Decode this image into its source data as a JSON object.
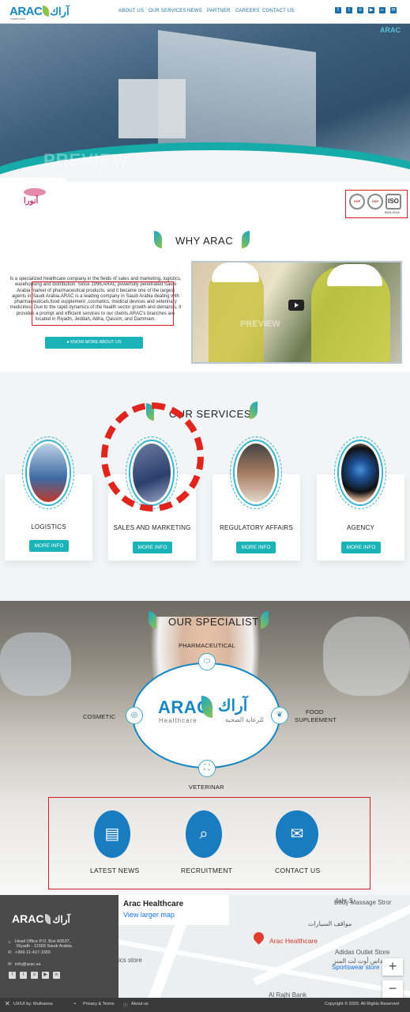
{
  "header": {
    "logo_en": "ARAC",
    "logo_ar": "آراك",
    "logo_tagline": "Healthcare",
    "nav": [
      "ABOUT US",
      "OUR SERVICES",
      "NEWS",
      "PARTNER",
      "CAREERS",
      "CONTACT US"
    ],
    "social": [
      {
        "icon": "facebook-icon",
        "glyph": "f"
      },
      {
        "icon": "twitter-icon",
        "glyph": "t"
      },
      {
        "icon": "instagram-icon",
        "glyph": "o"
      },
      {
        "icon": "youtube-icon",
        "glyph": "▶"
      },
      {
        "icon": "linkedin-icon",
        "glyph": "in"
      },
      {
        "icon": "email-icon",
        "glyph": "✉"
      }
    ]
  },
  "hero": {
    "watermark": "PREVIEW",
    "logo": "ARAC"
  },
  "partners": {
    "brand": "أنورا",
    "certs": [
      "GDP",
      "GSP",
      "ISO",
      "9001:2015"
    ]
  },
  "why": {
    "title": "WHY ARAC",
    "paragraph": "Is a specialized healthcare company in the fields of sales and marketing, logistics, warehousing and distribution. Since 1996,ARAC powerfully penetrated Saudi Arabia market of pharmaceutical products, and it became one of the largest agents in Saudi Arabia.ARAC is a leading company in Saudi Arabia dealing with pharmaceuticals,food supplement ,cosmetics, medical devices and veterinary medicines. Due to the rapid dynamics of the health sector growth and demands, it provides a prompt and efficient services to our clients.ARAC's branches are located in Riyadh, Jeddah, Abha, Qassim, and Dammam.",
    "button": "KNOW MORE ABOUT US",
    "video_watermark": "PREVIEW"
  },
  "services": {
    "title": "OUR SERVICES",
    "items": [
      {
        "label": "LOGISTICS",
        "button": "MORE INFO"
      },
      {
        "label": "SALES AND MARKETING",
        "button": "MORE INFO"
      },
      {
        "label": "REGULATORY AFFAIRS",
        "button": "MORE INFO"
      },
      {
        "label": "AGENCY",
        "button": "MORE INFO"
      }
    ]
  },
  "specialist": {
    "title": "OUR SPECIALIST",
    "logo_en": "ARAC",
    "logo_ar": "آراك",
    "logo_tag_en": "Healthcare",
    "logo_tag_ar": "للرعاية الصحية",
    "items": {
      "pharmaceutical": "PHARMACEUTICAL",
      "cosmetic": "COSMETIC",
      "food_line1": "FOOD",
      "food_line2": "SUPLEEMENT",
      "veterinar": "VETERINAR"
    }
  },
  "quick_links": [
    {
      "label": "LATEST NEWS",
      "icon": "newspaper-icon",
      "glyph": "▤"
    },
    {
      "label": "RECRUITMENT",
      "icon": "resume-search-icon",
      "glyph": "⌕"
    },
    {
      "label": "CONTACT US",
      "icon": "mail-open-icon",
      "glyph": "✉"
    }
  ],
  "footer": {
    "logo_en": "ARAC",
    "logo_ar": "آراك",
    "address_line1": "Head Office P.O. Box 60537,",
    "address_line2": "Riyadh - 11555 Saudi Arabia.",
    "phone": "+966-11-417-1555",
    "email": "info@arac.sa",
    "credit": "UX/UI by: Muthanna",
    "privacy": "Privacy & Terms",
    "about": "About us",
    "copyright": "Copyright © 2020. All Rights Reserved"
  },
  "map": {
    "title": "Arac Healthcare",
    "link": "Larger map",
    "link_full": "View larger map",
    "pin_label": "Arac Healthcare",
    "places": [
      "Body Massage Stror",
      "Jahr S",
      "مواقف السيارات",
      "Adidas Outlet Store",
      "اديداس أوت لت المنز",
      "Sportswear store",
      "ics store",
      "Al Rajhi Bank"
    ]
  },
  "colors": {
    "brand_blue": "#1687c5",
    "teal_button": "#1ab3b8",
    "leaf_green": "#8bc34a",
    "annotation_red": "#d02020"
  }
}
